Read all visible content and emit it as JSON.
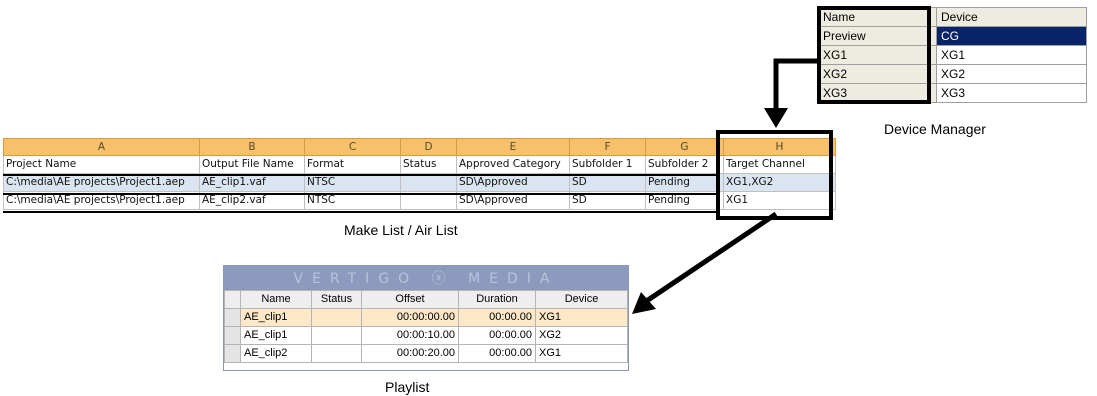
{
  "device_manager": {
    "caption": "Device Manager",
    "headers": [
      "Name",
      "Device"
    ],
    "rows": [
      {
        "name": "Preview",
        "device": "CG",
        "selected": true
      },
      {
        "name": "XG1",
        "device": "XG1"
      },
      {
        "name": "XG2",
        "device": "XG2"
      },
      {
        "name": "XG3",
        "device": "XG3"
      }
    ]
  },
  "make_list": {
    "caption": "Make List / Air List",
    "column_letters": [
      "A",
      "B",
      "C",
      "D",
      "E",
      "F",
      "G",
      "H"
    ],
    "field_headers": [
      "Project Name",
      "Output File Name",
      "Format",
      "Status",
      "Approved Category",
      "Subfolder 1",
      "Subfolder 2",
      "Target Channel"
    ],
    "rows": [
      [
        "C:\\media\\AE projects\\Project1.aep",
        "AE_clip1.vaf",
        "NTSC",
        "",
        "SD\\Approved",
        "SD",
        "Pending",
        "XG1,XG2"
      ],
      [
        "C:\\media\\AE projects\\Project1.aep",
        "AE_clip2.vaf",
        "NTSC",
        "",
        "SD\\Approved",
        "SD",
        "Pending",
        "XG1"
      ]
    ]
  },
  "playlist": {
    "caption": "Playlist",
    "banner": "VERTIGO ⓧ MEDIA",
    "headers": [
      "Name",
      "Status",
      "Offset",
      "Duration",
      "Device"
    ],
    "rows": [
      [
        "AE_clip1",
        "",
        "00:00:00.00",
        "00:00.00",
        "XG1"
      ],
      [
        "AE_clip1",
        "",
        "00:00:10.00",
        "00:00.00",
        "XG2"
      ],
      [
        "AE_clip2",
        "",
        "00:00:20.00",
        "00:00.00",
        "XG1"
      ]
    ]
  }
}
